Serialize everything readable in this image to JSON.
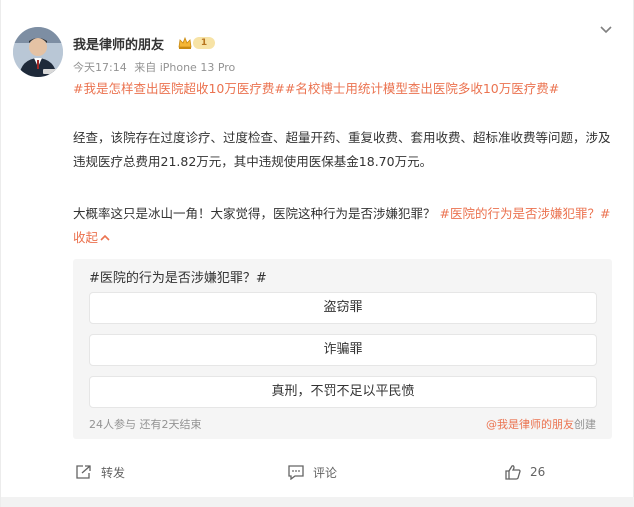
{
  "post": {
    "author": {
      "name": "我是律师的朋友",
      "level": "1",
      "avatar_icon": "avatar-photo"
    },
    "time": "今天17:14",
    "source": "来自 iPhone 13 Pro",
    "topics": [
      "#我是怎样查出医院超收10万医疗费#",
      "#名校博士用统计模型查出医院多收10万医疗费#"
    ],
    "paragraph1": "经查，该院存在过度诊疗、过度检查、超量开药、重复收费、套用收费、超标准收费等问题，涉及违规医疗总费用21.82万元，其中违规使用医保基金18.70万元。",
    "paragraph2_text": "大概率这只是冰山一角！大家觉得，医院这种行为是否涉嫌犯罪？ ",
    "paragraph2_tag": "#医院的行为是否涉嫌犯罪？#",
    "collapse_label": "收起",
    "accent_color": "#eb7350"
  },
  "poll": {
    "title": "#医院的行为是否涉嫌犯罪？#",
    "options": [
      "盗窃罪",
      "诈骗罪",
      "真刑，不罚不足以平民愤"
    ],
    "stats": "24人参与 还有2天结束",
    "creator_name": "@我是律师的朋友",
    "creator_suffix": "创建"
  },
  "actions": {
    "repost_label": "转发",
    "comment_label": "评论",
    "like_count": "26"
  }
}
